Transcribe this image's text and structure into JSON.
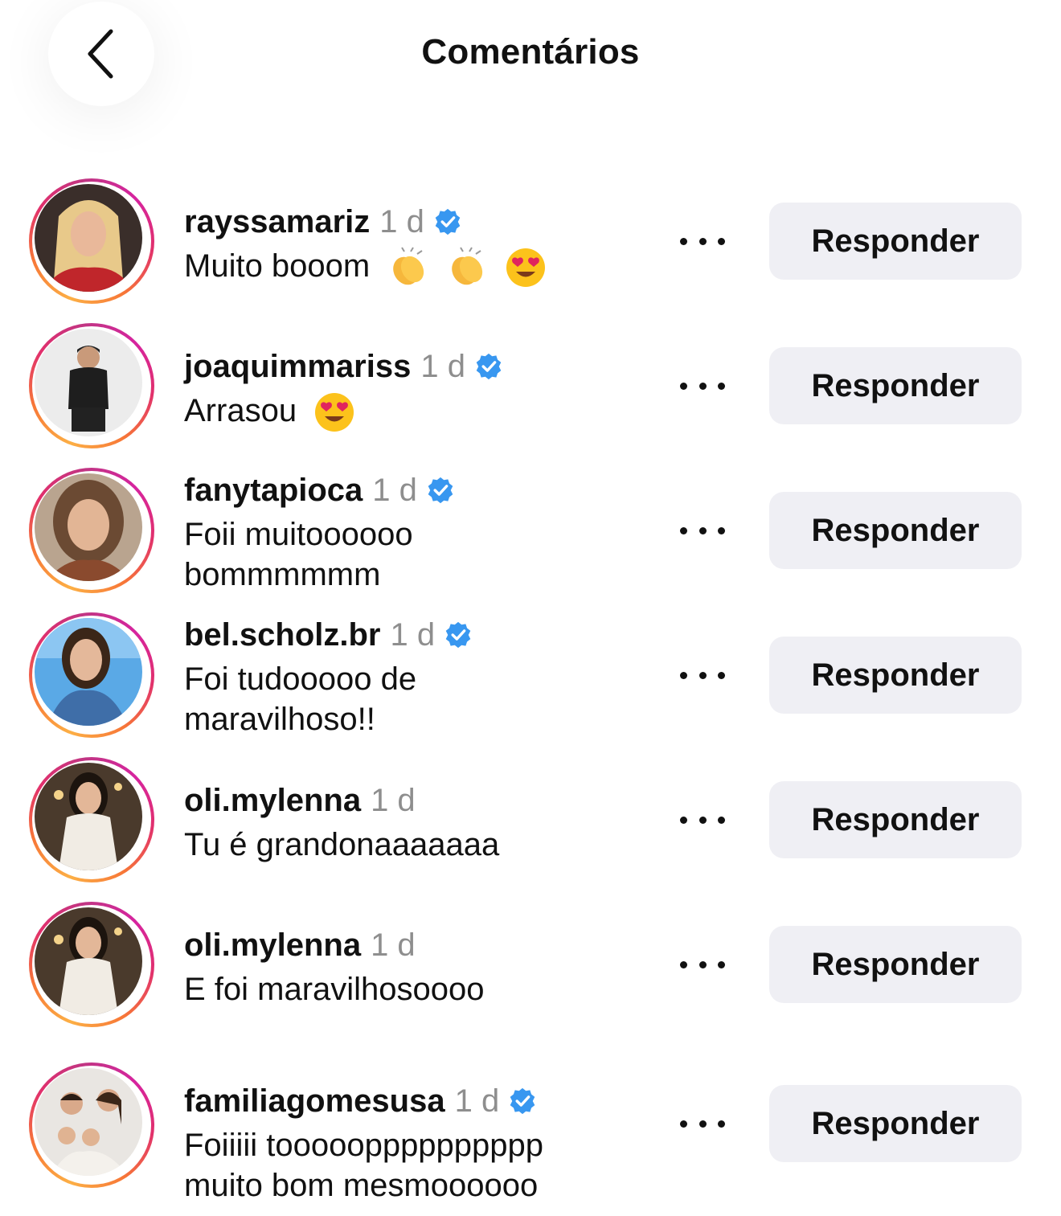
{
  "header": {
    "title": "Comentários",
    "back_icon": "chevron-left-icon"
  },
  "colors": {
    "verified": "#3897f0",
    "button_bg": "#efeff4",
    "time_gray": "#8e8e8e",
    "ring_gradient": [
      "#fcaf45",
      "#f77737",
      "#e1306c",
      "#c13584"
    ]
  },
  "comments": [
    {
      "username": "rayssamariz",
      "time": "1 d",
      "verified": true,
      "text": "Muito booom",
      "emojis": [
        "clapping-hands-emoji",
        "clapping-hands-emoji",
        "heart-eyes-emoji"
      ],
      "more_icon": "more-horizontal-icon",
      "reply_label": "Responder"
    },
    {
      "username": "joaquimmariss",
      "time": "1 d",
      "verified": true,
      "text": "Arrasou",
      "emojis": [
        "heart-eyes-emoji"
      ],
      "more_icon": "more-horizontal-icon",
      "reply_label": "Responder"
    },
    {
      "username": "fanytapioca",
      "time": "1 d",
      "verified": true,
      "text": "Foii muitoooooo bommmmmm",
      "emojis": [],
      "more_icon": "more-horizontal-icon",
      "reply_label": "Responder"
    },
    {
      "username": "bel.scholz.br",
      "time": "1 d",
      "verified": true,
      "text": "Foi tudooooo de maravilhoso!!",
      "emojis": [],
      "more_icon": "more-horizontal-icon",
      "reply_label": "Responder"
    },
    {
      "username": "oli.mylenna",
      "time": "1 d",
      "verified": false,
      "text": "Tu é grandonaaaaaaa",
      "emojis": [],
      "more_icon": "more-horizontal-icon",
      "reply_label": "Responder"
    },
    {
      "username": "oli.mylenna",
      "time": "1 d",
      "verified": false,
      "text": "E foi maravilhosoooo",
      "emojis": [],
      "more_icon": "more-horizontal-icon",
      "reply_label": "Responder"
    },
    {
      "username": "familiagomesusa",
      "time": "1 d",
      "verified": true,
      "text": "Foiiiii tooooopppppppppp muito bom mesmoooooo",
      "emojis": [],
      "more_icon": "more-horizontal-icon",
      "reply_label": "Responder"
    }
  ]
}
